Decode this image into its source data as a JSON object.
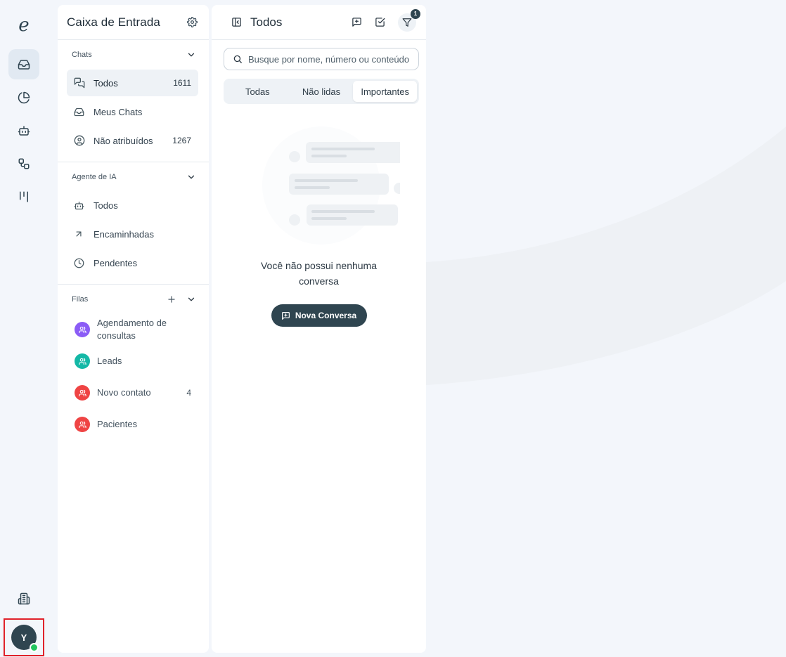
{
  "rail": {
    "logo": "e",
    "nav_icons": [
      "inbox-icon",
      "pie-chart-icon",
      "bot-icon",
      "workflow-icon",
      "kanban-icon"
    ],
    "bottom_icon": "building-icon",
    "avatar_initial": "Y",
    "status_color": "#22c55e"
  },
  "inbox": {
    "title": "Caixa de Entrada",
    "chats": {
      "label": "Chats",
      "items": [
        {
          "label": "Todos",
          "count": "1611"
        },
        {
          "label": "Meus Chats",
          "count": ""
        },
        {
          "label": "Não atribuídos",
          "count": "1267"
        }
      ]
    },
    "ai": {
      "label": "Agente de IA",
      "items": [
        {
          "label": "Todos"
        },
        {
          "label": "Encaminhadas"
        },
        {
          "label": "Pendentes"
        }
      ]
    },
    "queues": {
      "label": "Filas",
      "items": [
        {
          "label": "Agendamento de consultas",
          "count": "",
          "color": "#8b5cf6"
        },
        {
          "label": "Leads",
          "count": "",
          "color": "#14b8a6"
        },
        {
          "label": "Novo contato",
          "count": "4",
          "color": "#ef4444"
        },
        {
          "label": "Pacientes",
          "count": "",
          "color": "#ef4444"
        }
      ]
    }
  },
  "conversations": {
    "title": "Todos",
    "filter_badge": "1",
    "search_placeholder": "Busque por nome, número ou conteúdo",
    "tabs": [
      "Todas",
      "Não lidas",
      "Importantes"
    ],
    "active_tab": "Importantes",
    "empty_message": "Você não possui nenhuma conversa",
    "new_button": "Nova Conversa"
  },
  "colors": {
    "accent": "#2f4550",
    "active_bg": "#e1e9f2"
  }
}
